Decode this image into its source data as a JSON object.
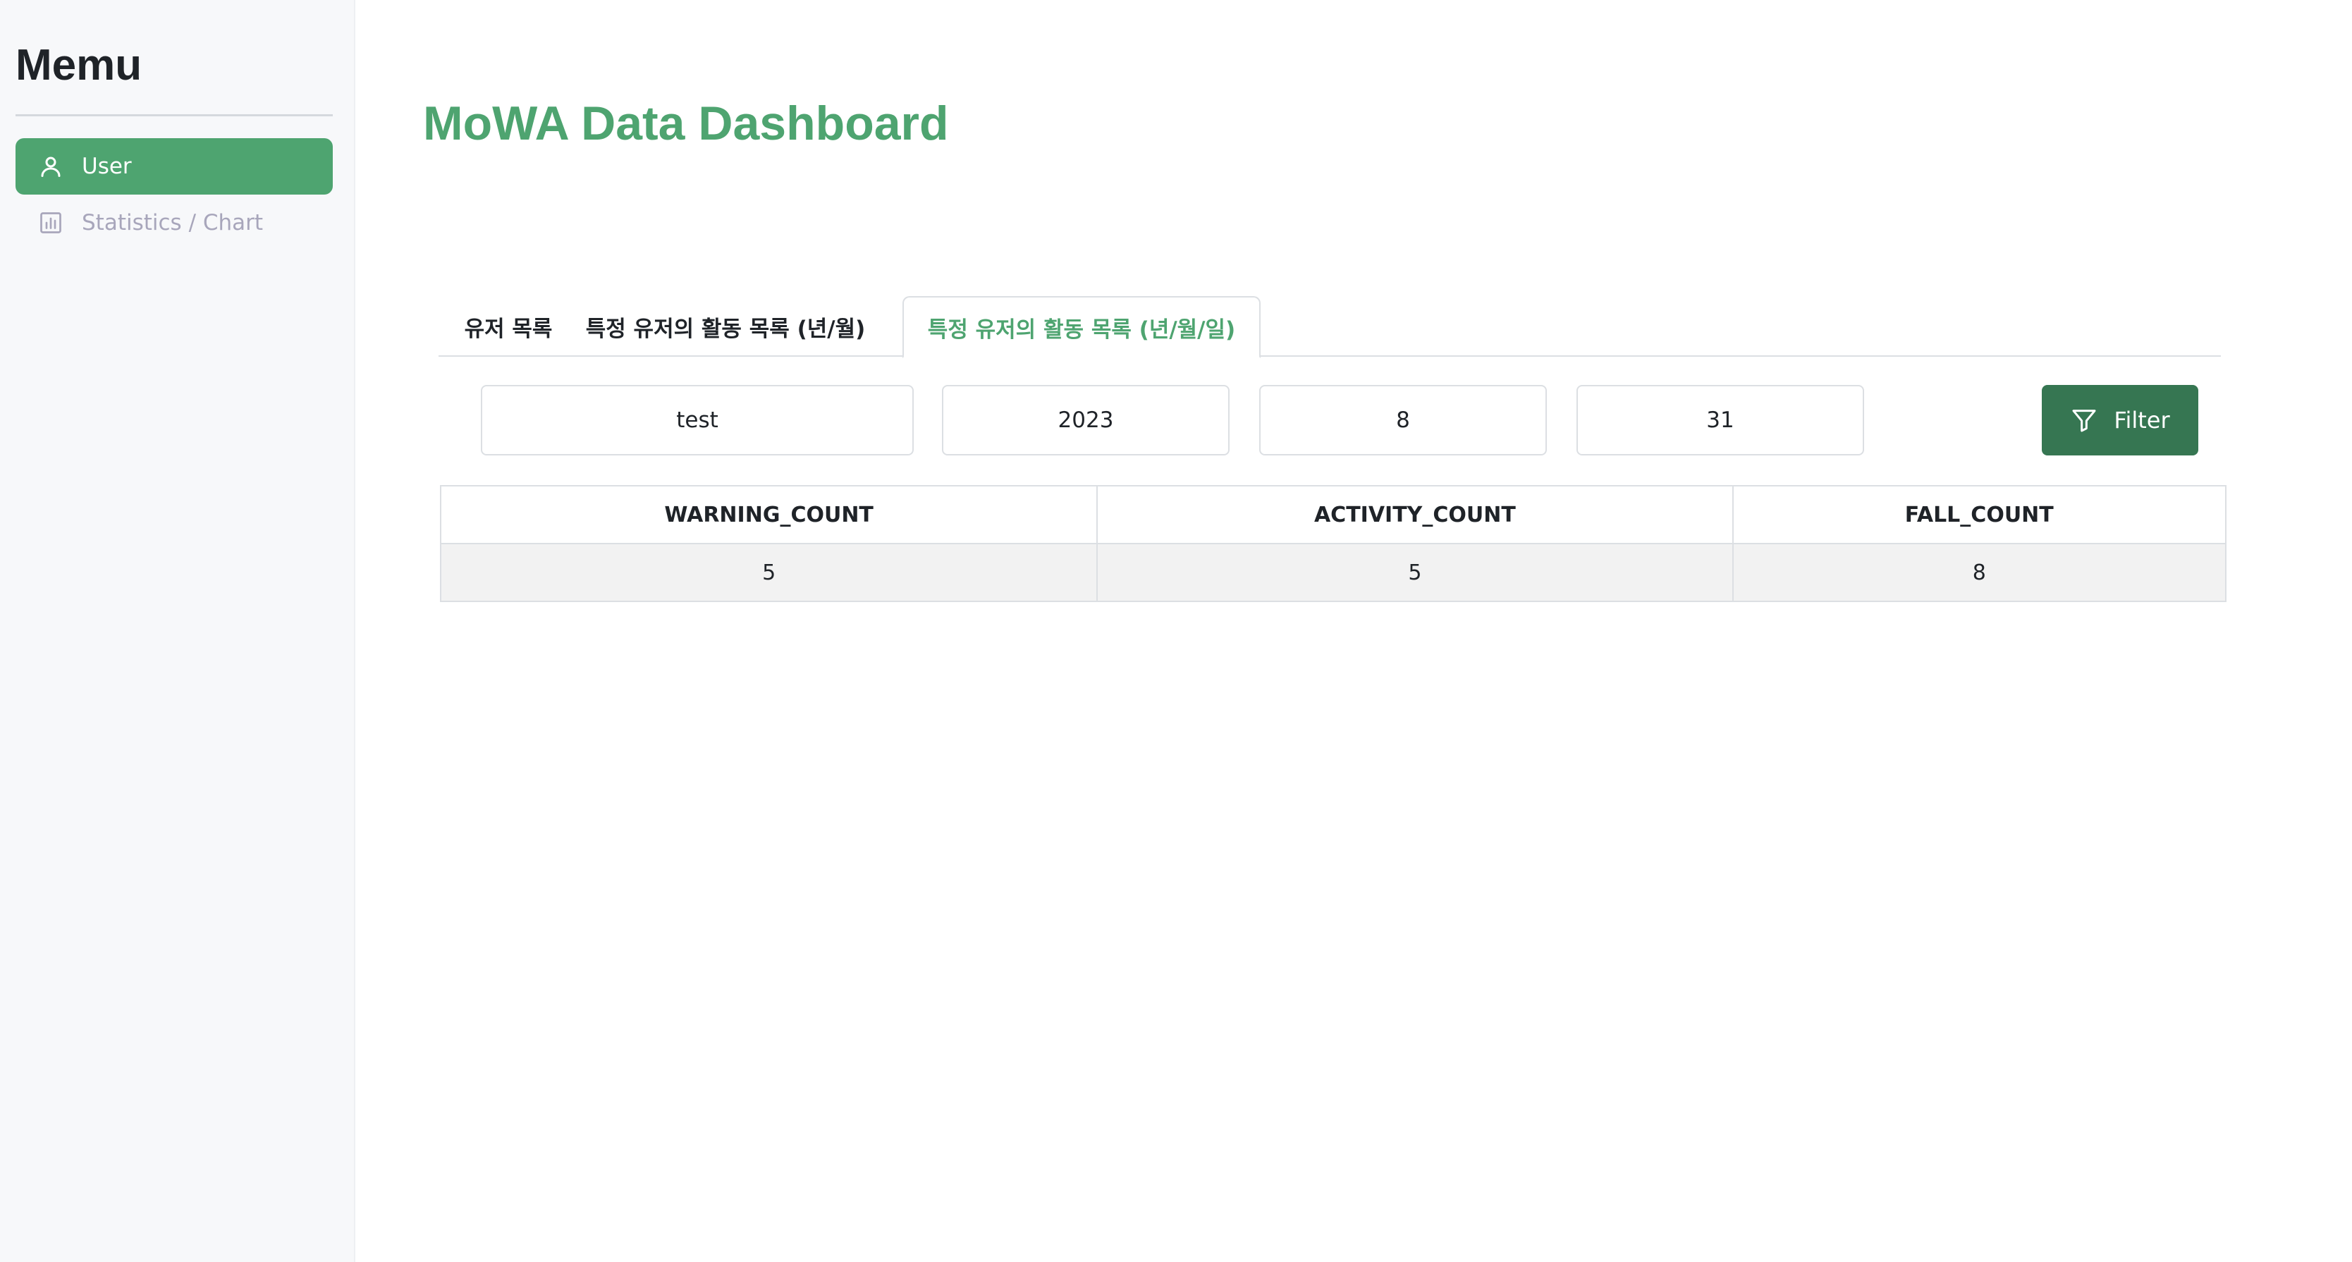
{
  "sidebar": {
    "title": "Memu",
    "items": [
      {
        "label": "User",
        "icon": "user-icon",
        "active": true
      },
      {
        "label": "Statistics / Chart",
        "icon": "bar-chart-icon",
        "active": false
      }
    ]
  },
  "header": {
    "title": "MoWA Data Dashboard"
  },
  "tabs": [
    {
      "label": "유저 목록"
    },
    {
      "label": "특정 유저의 활동 목록 (년/월)"
    },
    {
      "label": "특정 유저의 활동 목록 (년/월/일)",
      "active": true
    }
  ],
  "filters": {
    "user": "test",
    "year": "2023",
    "month": "8",
    "day": "31",
    "button_label": "Filter",
    "button_icon": "filter-icon"
  },
  "table": {
    "columns": [
      "WARNING_COUNT",
      "ACTIVITY_COUNT",
      "FALL_COUNT"
    ],
    "rows": [
      [
        "5",
        "5",
        "8"
      ]
    ]
  },
  "colors": {
    "accent": "#4ea470",
    "button": "#367652",
    "sidebar_bg": "#f7f8fa",
    "muted_text": "#a8a6bb"
  }
}
